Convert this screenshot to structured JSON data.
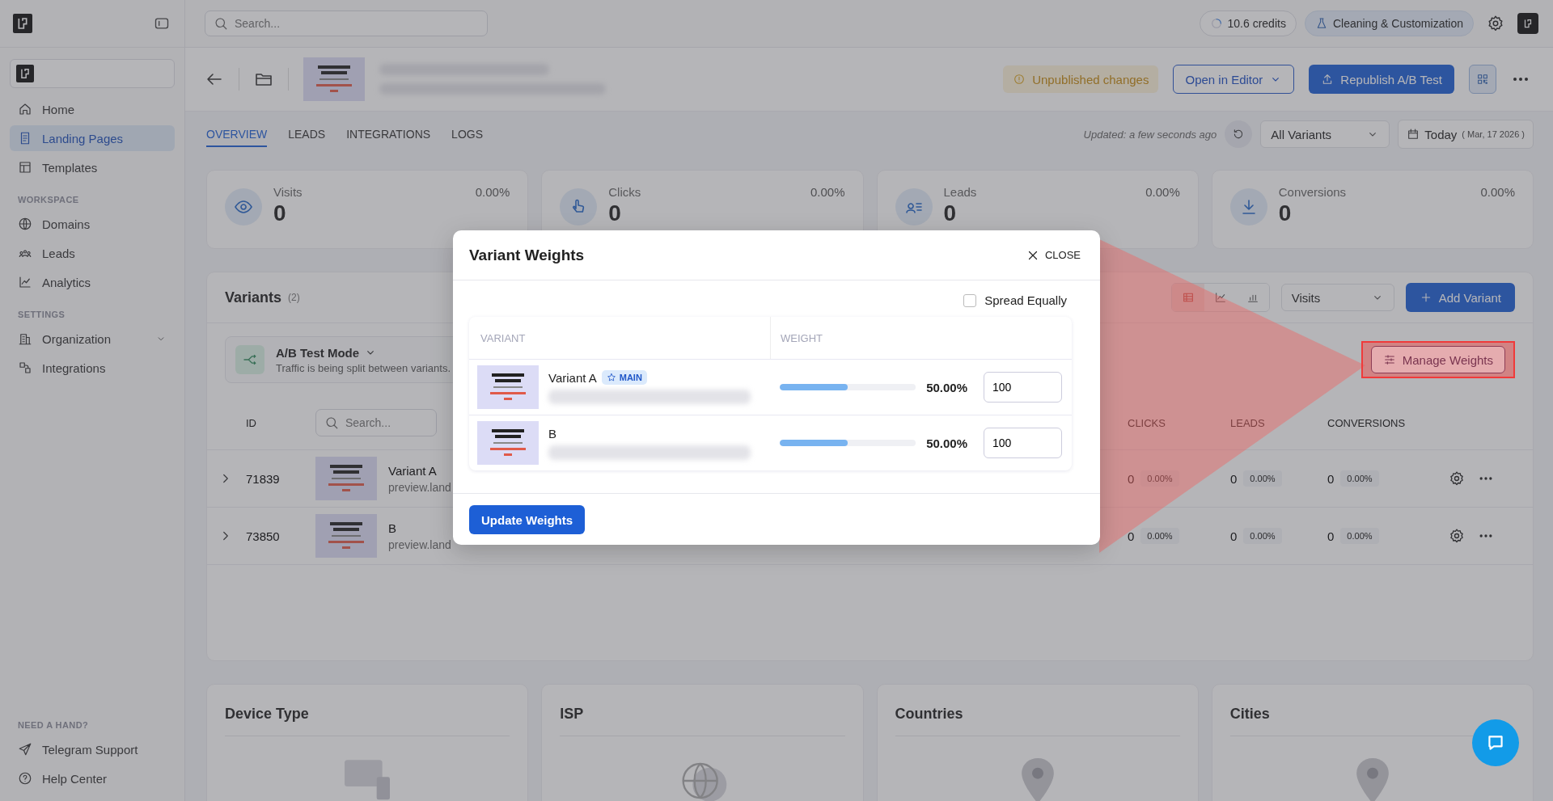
{
  "sidebar": {
    "nav": [
      {
        "label": "Home",
        "selected": false
      },
      {
        "label": "Landing Pages",
        "selected": true
      },
      {
        "label": "Templates",
        "selected": false
      }
    ],
    "groups": [
      {
        "heading": "WORKSPACE",
        "items": [
          {
            "label": "Domains",
            "kind": "link"
          },
          {
            "label": "Leads",
            "kind": "link"
          },
          {
            "label": "Analytics",
            "kind": "link"
          }
        ]
      },
      {
        "heading": "SETTINGS",
        "items": [
          {
            "label": "Organization",
            "kind": "expandable"
          },
          {
            "label": "Integrations",
            "kind": "link"
          }
        ]
      }
    ],
    "help": {
      "heading": "NEED A HAND?",
      "items": [
        "Telegram Support",
        "Help Center"
      ]
    }
  },
  "topbar": {
    "search": {
      "placeholder": "Search..."
    },
    "credits": "10.6 credits",
    "workspace": "Cleaning & Customization"
  },
  "header": {
    "status": "Unpublished changes",
    "open_editor": "Open in Editor",
    "republish": "Republish A/B Test"
  },
  "tabs": [
    {
      "label": "OVERVIEW",
      "selected": true
    },
    {
      "label": "LEADS",
      "selected": false
    },
    {
      "label": "INTEGRATIONS",
      "selected": false
    },
    {
      "label": "LOGS",
      "selected": false
    }
  ],
  "updated": "Updated: a few seconds ago",
  "variant_filter": "All Variants",
  "date": {
    "label": "Today",
    "detail": "( Mar, 17 2026 )"
  },
  "stats": [
    {
      "label": "Visits",
      "value": "0",
      "percent": "0.00%"
    },
    {
      "label": "Clicks",
      "value": "0",
      "percent": "0.00%"
    },
    {
      "label": "Leads",
      "value": "0",
      "percent": "0.00%"
    },
    {
      "label": "Conversions",
      "value": "0",
      "percent": "0.00%"
    }
  ],
  "variants": {
    "title": "Variants",
    "count": "(2)",
    "views": [
      {
        "selected": true
      },
      {
        "selected": false
      },
      {
        "selected": false
      }
    ],
    "metric": "Visits",
    "add": "Add Variant",
    "mode": {
      "title": "A/B Test Mode",
      "description": "Traffic is being split between variants.",
      "action": "Manage Weights"
    },
    "search": {
      "placeholder": "Search..."
    },
    "columns": {
      "id": "ID",
      "clicks": "CLICKS",
      "leads": "LEADS",
      "conversions": "CONVERSIONS"
    },
    "rows": [
      {
        "id": "71839",
        "name": "Variant A",
        "url": "preview.land",
        "clicks": "0",
        "clicks_percent": "0.00%",
        "leads": "0",
        "leads_percent": "0.00%",
        "conversions": "0",
        "conversions_percent": "0.00%"
      },
      {
        "id": "73850",
        "name": "B",
        "url": "preview.land",
        "clicks": "0",
        "clicks_percent": "0.00%",
        "leads": "0",
        "leads_percent": "0.00%",
        "conversions": "0",
        "conversions_percent": "0.00%"
      }
    ]
  },
  "panels": [
    "Device Type",
    "ISP",
    "Countries",
    "Cities"
  ],
  "modal": {
    "title": "Variant Weights",
    "close": "CLOSE",
    "spread_equally": {
      "label": "Spread Equally",
      "checked": false
    },
    "columns": [
      "VARIANT",
      "WEIGHT"
    ],
    "rows": [
      {
        "name": "Variant A",
        "main": true,
        "badge": "MAIN",
        "level": 0.5,
        "percent": "50.00%",
        "value": "100"
      },
      {
        "name": "B",
        "main": false,
        "level": 0.5,
        "percent": "50.00%",
        "value": "100"
      }
    ],
    "submit": "Update Weights"
  }
}
